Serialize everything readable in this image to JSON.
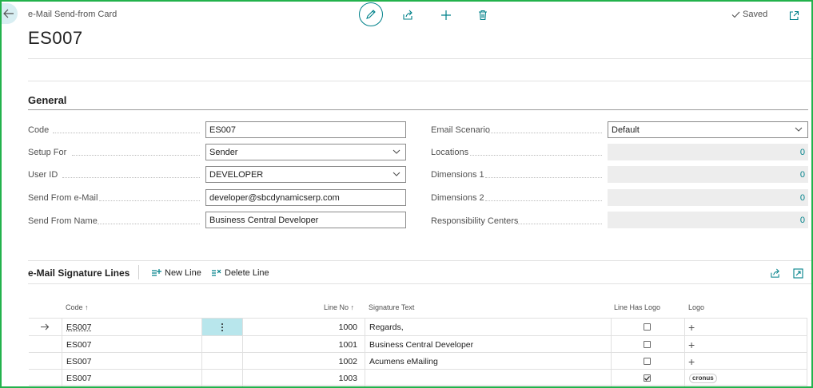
{
  "page": {
    "caption": "e-Mail Send-from Card",
    "title": "ES007",
    "status": "Saved"
  },
  "actions": {
    "back": "back-arrow-icon",
    "edit": "pencil-icon",
    "share": "share-icon",
    "new": "plus-icon",
    "delete": "trash-icon",
    "open_new_window": "open-in-new-window-icon"
  },
  "general": {
    "title": "General",
    "left_fields": [
      {
        "label": "Code",
        "value": "ES007",
        "type": "text"
      },
      {
        "label": "Setup For",
        "value": "Sender",
        "type": "select"
      },
      {
        "label": "User ID",
        "value": "DEVELOPER",
        "type": "select"
      },
      {
        "label": "Send From e-Mail",
        "value": "developer@sbcdynamicserp.com",
        "type": "text"
      },
      {
        "label": "Send From Name",
        "value": "Business Central Developer",
        "type": "text"
      }
    ],
    "right_fields": [
      {
        "label": "Email Scenario",
        "value": "Default",
        "type": "select"
      },
      {
        "label": "Locations",
        "value": "0",
        "type": "readonly"
      },
      {
        "label": "Dimensions 1",
        "value": "0",
        "type": "readonly"
      },
      {
        "label": "Dimensions 2",
        "value": "0",
        "type": "readonly"
      },
      {
        "label": "Responsibility Centers",
        "value": "0",
        "type": "readonly"
      }
    ]
  },
  "lines": {
    "title": "e-Mail Signature Lines",
    "new_line": "New Line",
    "delete_line": "Delete Line",
    "columns": {
      "code": "Code",
      "line_no": "Line No",
      "signature_text": "Signature Text",
      "has_logo": "Line Has Logo",
      "logo": "Logo"
    },
    "sort_indicator": "↑",
    "rows": [
      {
        "code": "ES007",
        "line_no": "1000",
        "signature_text": "Regards,",
        "has_logo": false,
        "logo": "+",
        "selected": true
      },
      {
        "code": "ES007",
        "line_no": "1001",
        "signature_text": "Business Central Developer",
        "has_logo": false,
        "logo": "+",
        "selected": false
      },
      {
        "code": "ES007",
        "line_no": "1002",
        "signature_text": "Acumens eMailing",
        "has_logo": false,
        "logo": "+",
        "selected": false
      },
      {
        "code": "ES007",
        "line_no": "1003",
        "signature_text": "",
        "has_logo": true,
        "logo": "cronus",
        "selected": false
      }
    ]
  },
  "colors": {
    "accent": "#00818a",
    "selected_cell": "#b8e6ec",
    "frame": "#22b24c"
  }
}
